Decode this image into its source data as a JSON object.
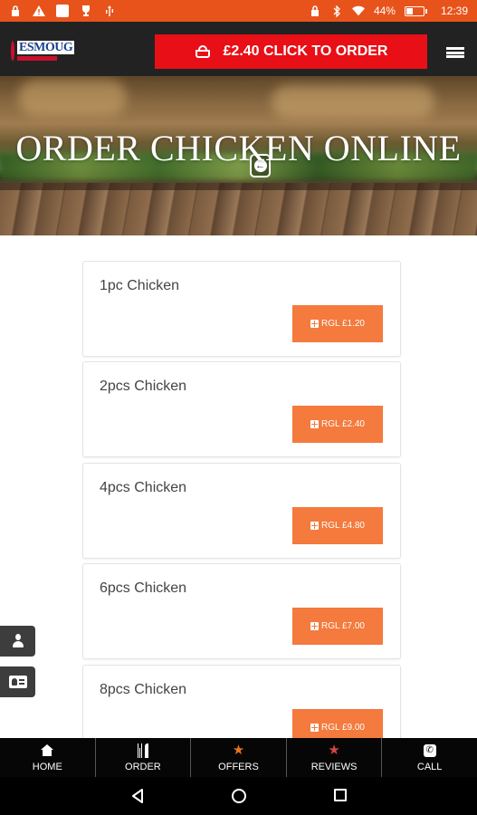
{
  "status_bar": {
    "battery_percent": "44%",
    "battery_level": 0.44,
    "time": "12:39",
    "icons": [
      "lock-icon",
      "warning-icon",
      "notification-icon",
      "usb-icon",
      "lock-icon",
      "bluetooth-icon",
      "wifi-icon",
      "battery-icon"
    ]
  },
  "header": {
    "logo_text": "ESMOUG",
    "order_button_label": "£2.40 CLICK TO ORDER",
    "menu_icon": "hamburger-icon"
  },
  "hero": {
    "title": "ORDER CHICKEN ONLINE",
    "back_icon": "arrow-left-icon"
  },
  "products": [
    {
      "name": "1pc Chicken",
      "price_label": "RGL £1.20"
    },
    {
      "name": "2pcs Chicken",
      "price_label": "RGL £2.40"
    },
    {
      "name": "4pcs Chicken",
      "price_label": "RGL £4.80"
    },
    {
      "name": "6pcs Chicken",
      "price_label": "RGL £7.00"
    },
    {
      "name": "8pcs Chicken",
      "price_label": "RGL £9.00"
    }
  ],
  "side_buttons": [
    "user-icon",
    "contact-card-icon"
  ],
  "bottom_nav": [
    {
      "label": "HOME",
      "icon": "home-icon"
    },
    {
      "label": "ORDER",
      "icon": "cutlery-icon"
    },
    {
      "label": "OFFERS",
      "icon": "star-icon",
      "icon_color": "#e8731c"
    },
    {
      "label": "REVIEWS",
      "icon": "star-icon",
      "icon_color": "#d64545"
    },
    {
      "label": "CALL",
      "icon": "phone-icon"
    }
  ],
  "colors": {
    "status_bar": "#e8531c",
    "header_bg": "#222222",
    "order_button": "#e80f16",
    "price_button": "#f47a3d",
    "bottom_nav_bg": "#060606"
  }
}
